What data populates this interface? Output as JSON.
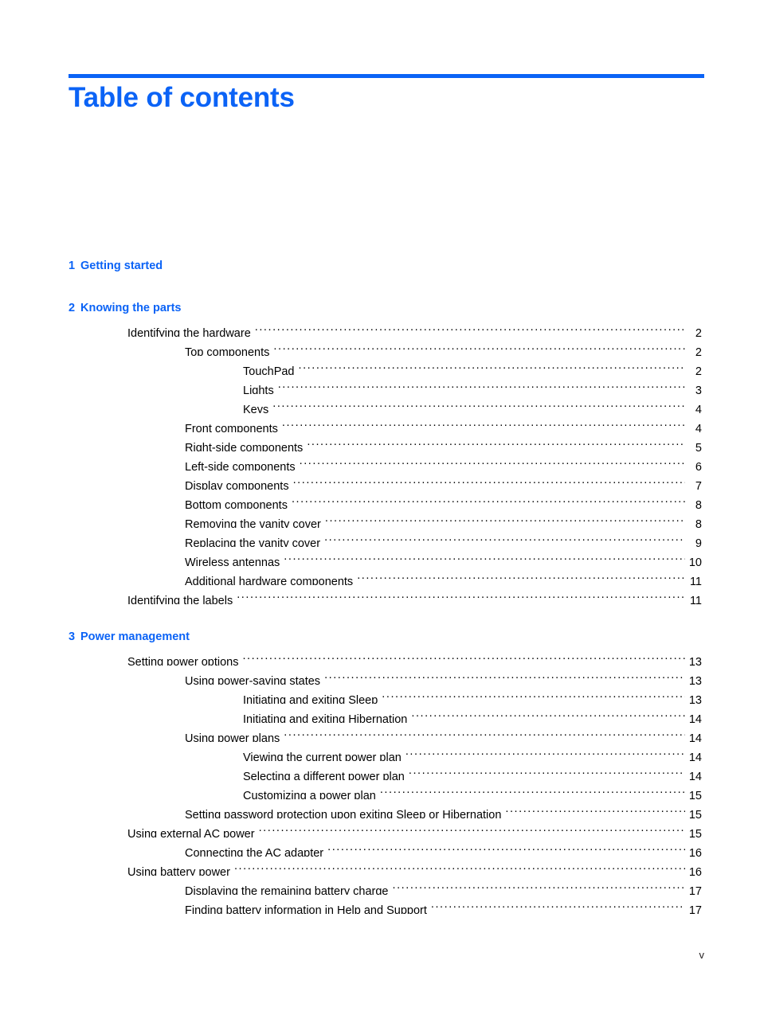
{
  "document": {
    "title": "Table of contents",
    "accent_color": "#0B63F6",
    "text_color": "#000000",
    "footer_page_label": "v"
  },
  "toc": {
    "chapters": [
      {
        "number": "1",
        "title": "Getting started",
        "entries": []
      },
      {
        "number": "2",
        "title": "Knowing the parts",
        "entries": [
          {
            "label": "Identifying the hardware",
            "page": "2",
            "level": 1
          },
          {
            "label": "Top components",
            "page": "2",
            "level": 2
          },
          {
            "label": "TouchPad",
            "page": "2",
            "level": 3
          },
          {
            "label": "Lights",
            "page": "3",
            "level": 3
          },
          {
            "label": "Keys",
            "page": "4",
            "level": 3
          },
          {
            "label": "Front components",
            "page": "4",
            "level": 2
          },
          {
            "label": "Right-side components",
            "page": "5",
            "level": 2
          },
          {
            "label": "Left-side components",
            "page": "6",
            "level": 2
          },
          {
            "label": "Display components",
            "page": "7",
            "level": 2
          },
          {
            "label": "Bottom components",
            "page": "8",
            "level": 2
          },
          {
            "label": "Removing the vanity cover",
            "page": "8",
            "level": 2
          },
          {
            "label": "Replacing the vanity cover",
            "page": "9",
            "level": 2
          },
          {
            "label": "Wireless antennas",
            "page": "10",
            "level": 2
          },
          {
            "label": "Additional hardware components",
            "page": "11",
            "level": 2
          },
          {
            "label": "Identifying the labels",
            "page": "11",
            "level": 1
          }
        ]
      },
      {
        "number": "3",
        "title": "Power management",
        "entries": [
          {
            "label": "Setting power options",
            "page": "13",
            "level": 1
          },
          {
            "label": "Using power-saving states",
            "page": "13",
            "level": 2
          },
          {
            "label": "Initiating and exiting Sleep",
            "page": "13",
            "level": 3
          },
          {
            "label": "Initiating and exiting Hibernation",
            "page": "14",
            "level": 3
          },
          {
            "label": "Using power plans",
            "page": "14",
            "level": 2
          },
          {
            "label": "Viewing the current power plan",
            "page": "14",
            "level": 3
          },
          {
            "label": "Selecting a different power plan",
            "page": "14",
            "level": 3
          },
          {
            "label": "Customizing a power plan",
            "page": "15",
            "level": 3
          },
          {
            "label": "Setting password protection upon exiting Sleep or Hibernation",
            "page": "15",
            "level": 2
          },
          {
            "label": "Using external AC power",
            "page": "15",
            "level": 1
          },
          {
            "label": "Connecting the AC adapter",
            "page": "16",
            "level": 2
          },
          {
            "label": "Using battery power",
            "page": "16",
            "level": 1
          },
          {
            "label": "Displaying the remaining battery charge",
            "page": "17",
            "level": 2
          },
          {
            "label": "Finding battery information in Help and Support",
            "page": "17",
            "level": 2
          }
        ]
      }
    ]
  }
}
